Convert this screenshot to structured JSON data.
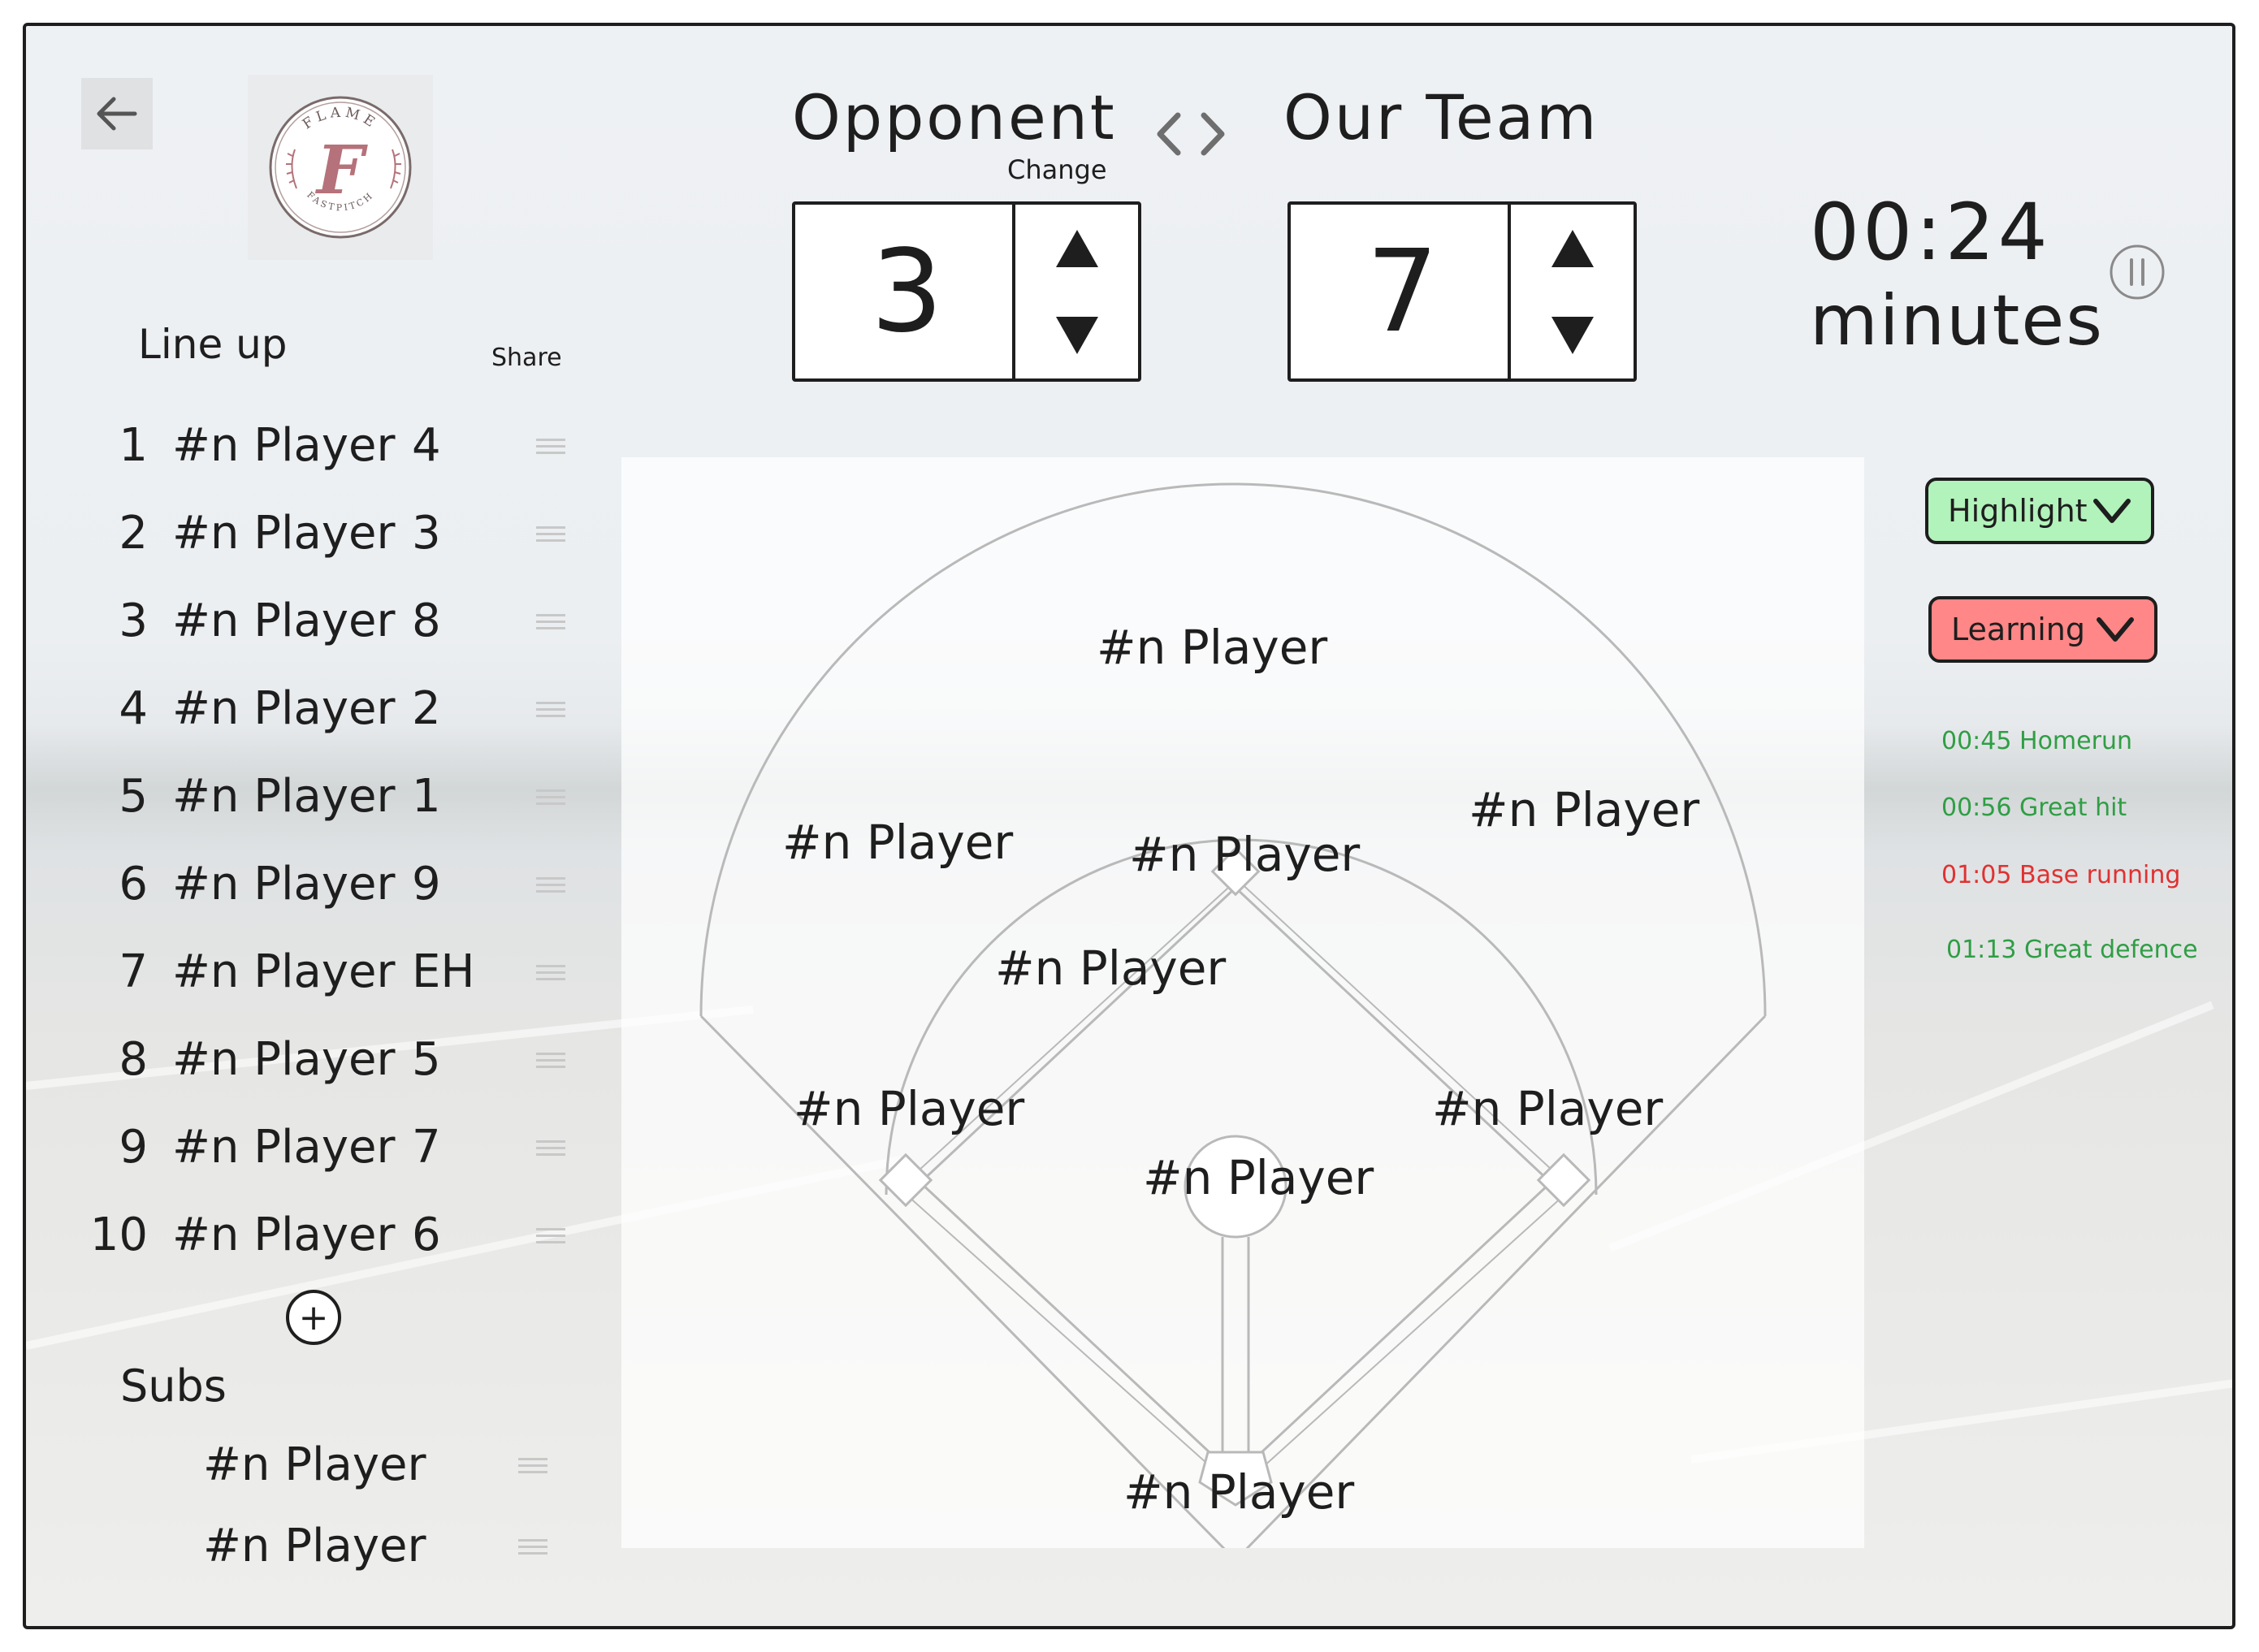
{
  "header": {
    "opponent_label": "Opponent",
    "our_team_label": "Our Team",
    "change_label": "Change",
    "swap_icon": "swap-arrows-icon"
  },
  "score": {
    "opponent": "3",
    "ours": "7"
  },
  "timer": {
    "time": "00:24",
    "unit": "minutes"
  },
  "lineup": {
    "title": "Line up",
    "share_label": "Share",
    "players": [
      {
        "order": "1",
        "name": "#n Player",
        "position": "4"
      },
      {
        "order": "2",
        "name": "#n Player",
        "position": "3"
      },
      {
        "order": "3",
        "name": "#n Player",
        "position": "8"
      },
      {
        "order": "4",
        "name": "#n Player",
        "position": "2"
      },
      {
        "order": "5",
        "name": "#n Player",
        "position": "1"
      },
      {
        "order": "6",
        "name": "#n Player",
        "position": "9"
      },
      {
        "order": "7",
        "name": "#n Player",
        "position": "EH"
      },
      {
        "order": "8",
        "name": "#n Player",
        "position": "5"
      },
      {
        "order": "9",
        "name": "#n Player",
        "position": "7"
      },
      {
        "order": "10",
        "name": "#n Player",
        "position": "6"
      }
    ]
  },
  "subs": {
    "title": "Subs",
    "players": [
      "#n Player",
      "#n Player"
    ]
  },
  "field": {
    "center_field": "#n Player",
    "left_field": "#n Player",
    "right_field": "#n Player",
    "second_base": "#n Player",
    "shortstop": "#n Player",
    "third_base": "#n Player",
    "first_base": "#n Player",
    "pitcher": "#n Player",
    "catcher": "#n Player"
  },
  "notes": {
    "highlight_label": "Highlight",
    "learning_label": "Learning",
    "events": [
      {
        "time": "00:45",
        "text": "Homerun",
        "type": "highlight"
      },
      {
        "time": "00:56",
        "text": "Great hit",
        "type": "highlight"
      },
      {
        "time": "01:05",
        "text": "Base running",
        "type": "learning"
      },
      {
        "time": "01:13",
        "text": "Great defence",
        "type": "highlight"
      }
    ]
  },
  "logo": {
    "text_top": "FLAME",
    "text_bottom": "FASTPITCH",
    "letter": "F"
  },
  "colors": {
    "highlight_bg": "#b2f2bb",
    "learning_bg": "#ff8787",
    "highlight_text": "#2f9e44",
    "learning_text": "#e03131",
    "logo_accent": "#b5727a"
  }
}
